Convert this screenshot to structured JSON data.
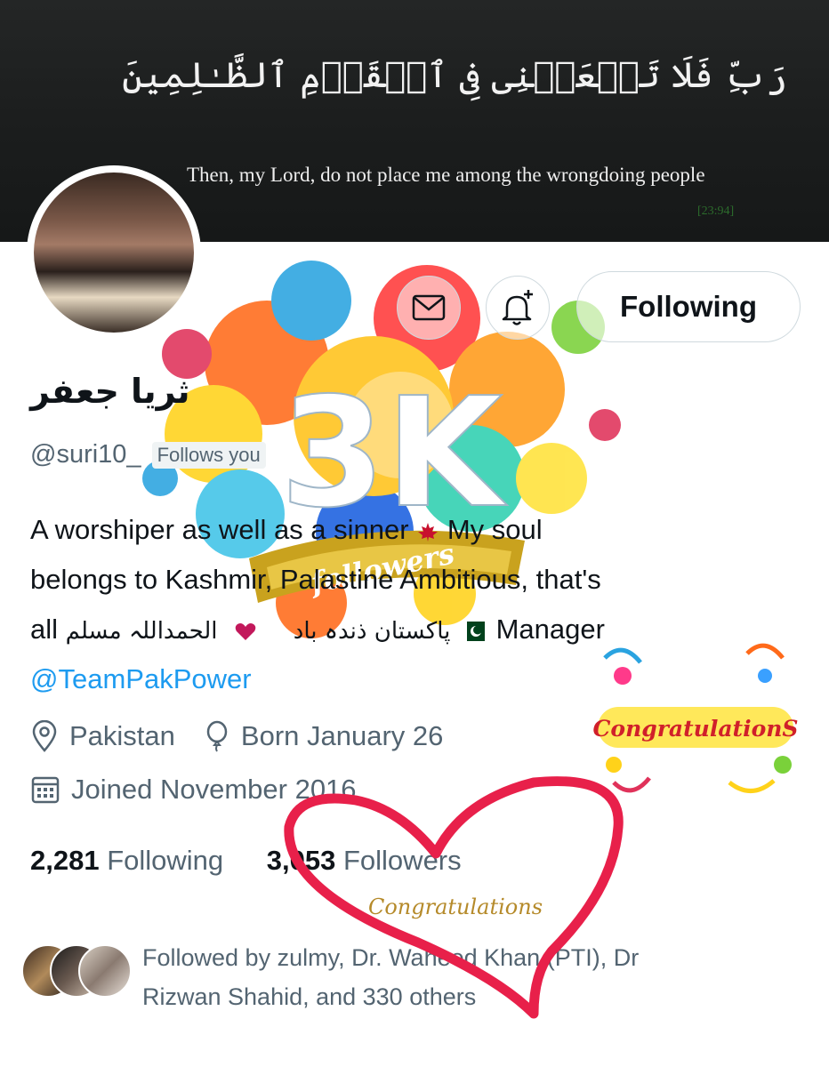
{
  "banner": {
    "arabic_text": "رَبِّ فَلَا تَجۡعَلۡنِى فِى ٱلۡقَوۡمِ ٱلظَّـٰلِمِينَ",
    "english_text": "Then, my Lord, do not place me among the wrongdoing people",
    "reference": "[23:94]"
  },
  "profile": {
    "display_name": "ثریا جعفر",
    "handle": "@suri10_",
    "follows_you": "Follows you",
    "bio": {
      "line1_a": "A worshiper as well as a sinner",
      "line1_b": "My soul",
      "line2": "belongs to Kashmir, Palastine  Ambitious, that's",
      "line3_all": "all",
      "line3_urdu": "پاکستان ذندہ باد",
      "line3_urdu2": "الحمداللہ مسلم",
      "line3_manager": "Manager",
      "mention": "@TeamPakPower"
    },
    "location": "Pakistan",
    "birthday": "Born January 26",
    "joined": "Joined November 2016"
  },
  "actions": {
    "message_icon": "envelope-icon",
    "notify_icon": "bell-plus-icon",
    "follow_label": "Following"
  },
  "stats": {
    "following_count": "2,281",
    "following_label": "Following",
    "followers_count": "3,053",
    "followers_label": "Followers"
  },
  "followed_by": {
    "text_line1": "Followed by zulmy, Dr. Waheed Khan (PTI), Dr",
    "text_line2": "Rizwan Shahid, and 330 others"
  },
  "decorations": {
    "milestone": "3K",
    "milestone_banner": "followers",
    "congrats_badge": "CongratulationS",
    "congrats_script": "Congratulations",
    "heart_color": "#e8204a",
    "link_color": "#1d9bf0"
  }
}
